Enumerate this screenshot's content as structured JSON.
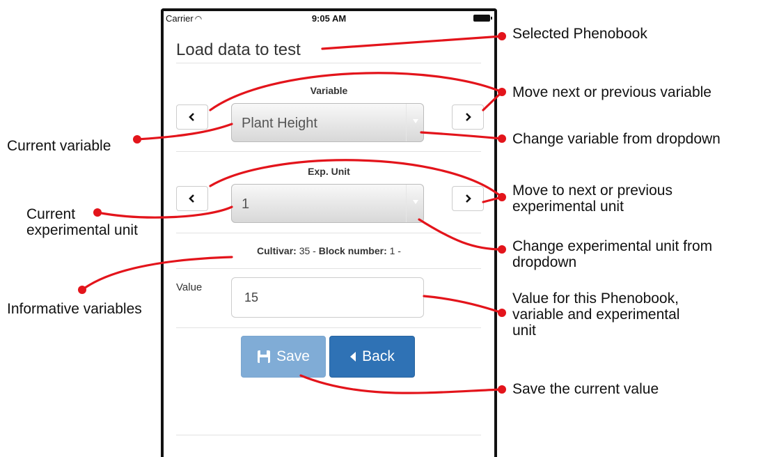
{
  "status_bar": {
    "carrier": "Carrier",
    "time": "9:05 AM"
  },
  "page": {
    "title": "Load data to test"
  },
  "variable": {
    "label": "Variable",
    "selected": "Plant Height"
  },
  "exp_unit": {
    "label": "Exp. Unit",
    "selected": "1"
  },
  "info": {
    "cultivar_label": "Cultivar:",
    "cultivar_value": " 35 - ",
    "block_label": "Block number:",
    "block_value": " 1 -"
  },
  "value_field": {
    "label": "Value",
    "value": "15"
  },
  "buttons": {
    "save": "Save",
    "back": "Back"
  },
  "annotations": {
    "selected_phenobook": "Selected Phenobook",
    "move_variable": "Move next or previous variable",
    "change_variable": "Change variable from dropdown",
    "current_variable": "Current variable",
    "move_unit_1": "Move to next or previous",
    "move_unit_2": "experimental unit",
    "current_unit_1": "Current",
    "current_unit_2": "experimental unit",
    "change_unit_1": "Change experimental unit from",
    "change_unit_2": "dropdown",
    "informative": "Informative variables",
    "value_desc_1": "Value for this Phenobook,",
    "value_desc_2": "variable and experimental",
    "value_desc_3": "unit",
    "save_desc": "Save the current value"
  },
  "colors": {
    "annotation_line": "#e3141b",
    "back_button": "#2f72b5",
    "save_button": "#80acd6"
  }
}
